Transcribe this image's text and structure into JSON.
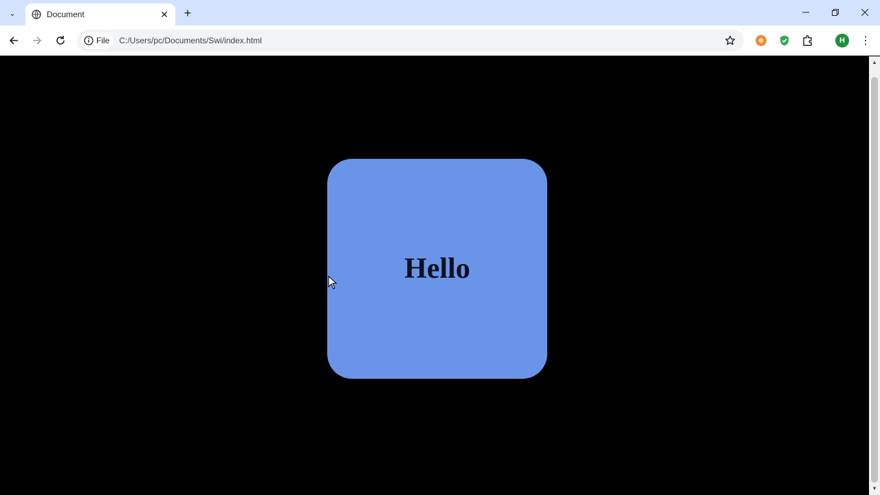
{
  "tab": {
    "title": "Document",
    "close_glyph": "✕"
  },
  "tab_search_glyph": "⌄",
  "new_tab_glyph": "+",
  "toolbar": {
    "chip_label": "File",
    "url": "C:/Users/pc/Documents/Swi/index.html"
  },
  "profile": {
    "initial": "H",
    "color": "#1e8e3e"
  },
  "menu_glyph": "⋮",
  "page": {
    "background": "#000000",
    "card": {
      "text": "Hello",
      "color": "#6a94e8"
    }
  },
  "scrollbar": {
    "up_glyph": "▲",
    "down_glyph": "▼"
  }
}
